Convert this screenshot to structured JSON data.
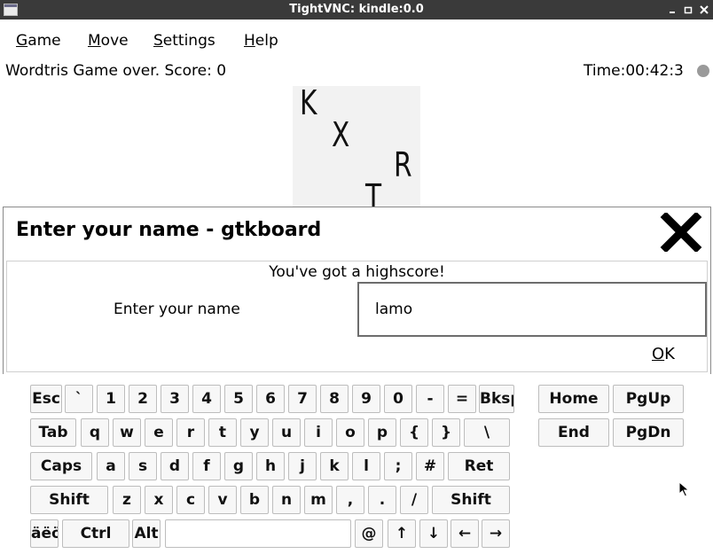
{
  "window": {
    "title": "TightVNC: kindle:0.0"
  },
  "menu": [
    {
      "name": "menu-game",
      "accel": "G",
      "rest": "ame"
    },
    {
      "name": "menu-move",
      "accel": "M",
      "rest": "ove"
    },
    {
      "name": "menu-settings",
      "accel": "S",
      "rest": "ettings"
    },
    {
      "name": "menu-help",
      "accel": "H",
      "rest": "elp"
    }
  ],
  "status": {
    "left": "Wordtris Game over. Score: 0",
    "right": "Time:00:42:3"
  },
  "board": {
    "letters": [
      "K",
      "X",
      "R",
      "T"
    ]
  },
  "dialog": {
    "title": "Enter your name - gtkboard",
    "message": "You've got a highscore!",
    "label": "Enter your name",
    "name_value": "lamo",
    "ok_accel": "O",
    "ok_rest": "K"
  },
  "keyboard": {
    "row1": [
      "Esc",
      "`",
      "1",
      "2",
      "3",
      "4",
      "5",
      "6",
      "7",
      "8",
      "9",
      "0",
      "-",
      "=",
      "Bksp"
    ],
    "row2": [
      "Tab",
      "q",
      "w",
      "e",
      "r",
      "t",
      "y",
      "u",
      "i",
      "o",
      "p",
      "{",
      "}",
      "\\"
    ],
    "row3": [
      "Caps",
      "a",
      "s",
      "d",
      "f",
      "g",
      "h",
      "j",
      "k",
      "l",
      ";",
      "#",
      "Ret"
    ],
    "row4": [
      "Shift",
      "z",
      "x",
      "c",
      "v",
      "b",
      "n",
      "m",
      ",",
      ".",
      "/",
      "Shift"
    ],
    "row5": [
      "äëö",
      "Ctrl",
      "Alt",
      "",
      "@",
      "↑",
      "↓",
      "←",
      "→"
    ],
    "nav": [
      "Home",
      "PgUp",
      "End",
      "PgDn"
    ]
  }
}
